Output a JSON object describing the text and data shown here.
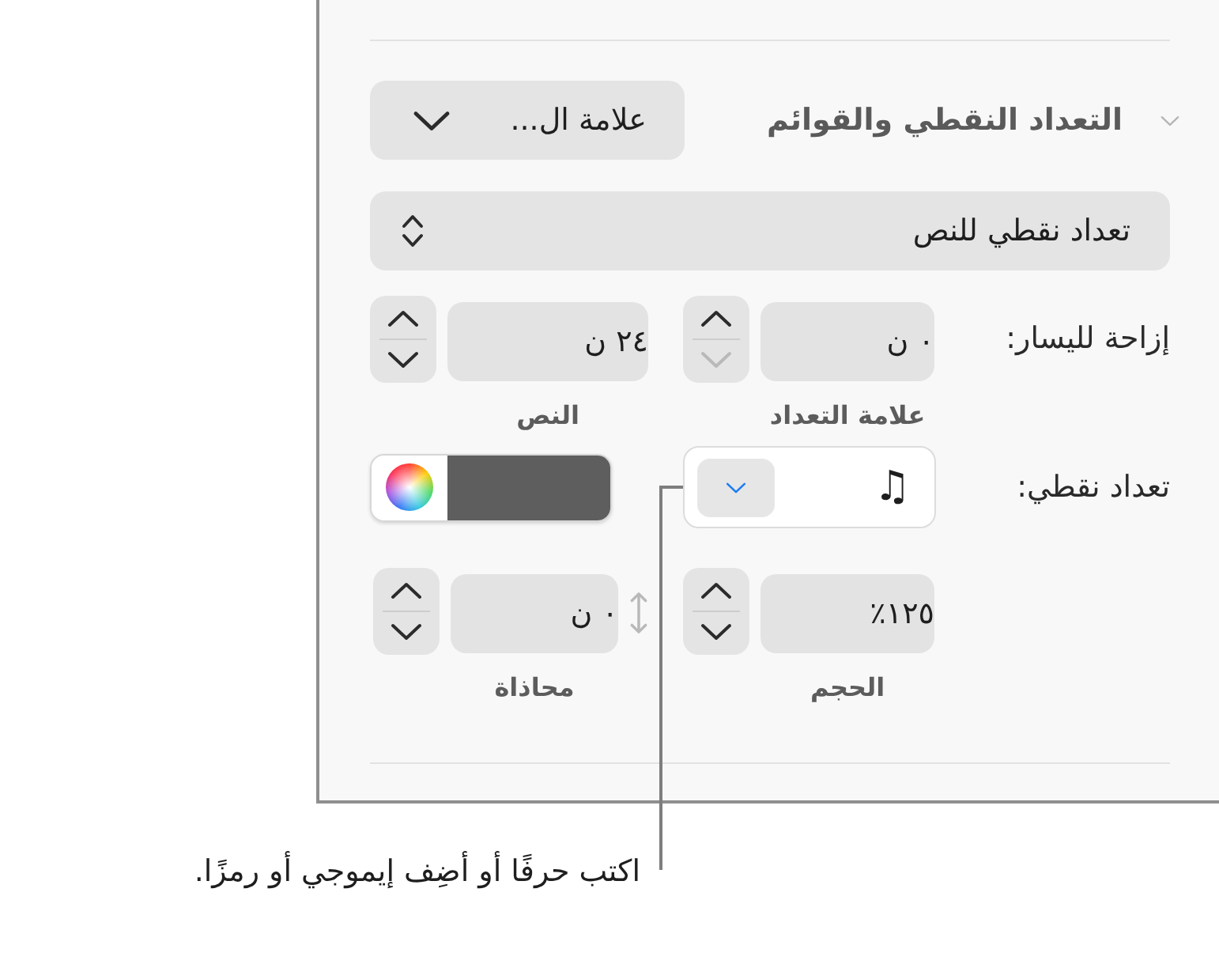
{
  "panel": {
    "section": {
      "title": "التعداد النقطي والقوائم",
      "expanded": true,
      "preset_menu": {
        "value": "علامة ال..."
      }
    },
    "list_style_menu": {
      "value": "تعداد نقطي للنص"
    },
    "indent": {
      "label": "إزاحة لليسار:",
      "bullet_field": {
        "value": "٠ ن",
        "caption": "علامة التعداد",
        "down_disabled": true
      },
      "text_field": {
        "value": "٢٤ ن",
        "caption": "النص",
        "down_disabled": false
      }
    },
    "bullet": {
      "label": "تعداد نقطي:",
      "value": "♫",
      "color_well": {
        "color": "#5e5e5e"
      }
    },
    "size_field": {
      "value": "١٢٥٪",
      "caption": "الحجم",
      "down_disabled": false
    },
    "alignment_field": {
      "value": "٠ ن",
      "caption": "محاذاة",
      "down_disabled": false
    }
  },
  "callout": {
    "text": "اكتب حرفًا أو أضِف إيموجي أو رمزًا."
  }
}
